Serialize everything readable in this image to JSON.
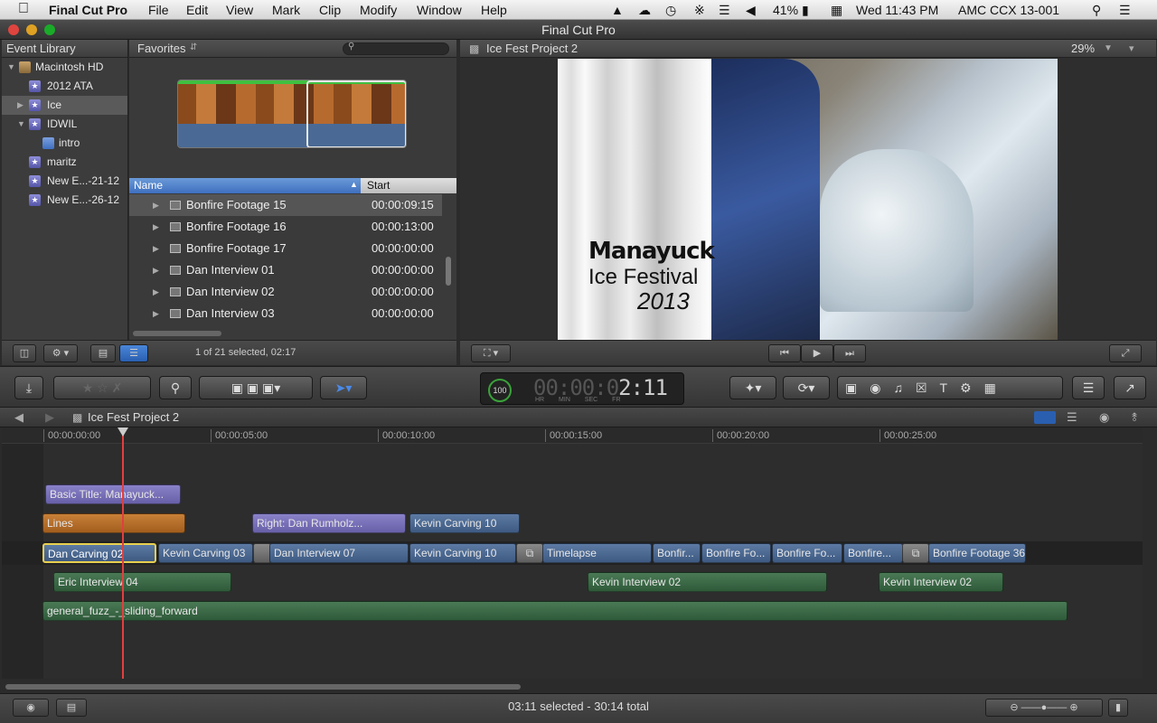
{
  "menubar": {
    "apple": "",
    "app_name": "Final Cut Pro",
    "menus": [
      "File",
      "Edit",
      "View",
      "Mark",
      "Clip",
      "Modify",
      "Window",
      "Help"
    ],
    "battery": "41%",
    "clock": "Wed 11:43 PM",
    "user": "AMC CCX 13-001"
  },
  "window": {
    "title": "Final Cut Pro"
  },
  "event_library": {
    "title": "Event Library",
    "items": [
      {
        "label": "Macintosh HD",
        "icon": "hard-drive-icon",
        "expanded": true
      },
      {
        "label": "2012 ATA",
        "icon": "event-star-icon"
      },
      {
        "label": "Ice",
        "icon": "event-star-icon",
        "selected": true
      },
      {
        "label": "IDWIL",
        "icon": "event-star-icon",
        "expanded": true
      },
      {
        "label": "intro",
        "icon": "keyword-collection-icon"
      },
      {
        "label": "maritz",
        "icon": "event-star-icon"
      },
      {
        "label": "New E...-21-12",
        "icon": "event-star-icon"
      },
      {
        "label": "New E...-26-12",
        "icon": "event-star-icon"
      }
    ]
  },
  "browser": {
    "filter": "Favorites",
    "columns": {
      "name": "Name",
      "start": "Start"
    },
    "rows": [
      {
        "name": "Bonfire Footage 15",
        "start": "00:00:09:15",
        "selected": true
      },
      {
        "name": "Bonfire Footage 16",
        "start": "00:00:13:00"
      },
      {
        "name": "Bonfire Footage 17",
        "start": "00:00:00:00"
      },
      {
        "name": "Dan Interview 01",
        "start": "00:00:00:00"
      },
      {
        "name": "Dan Interview 02",
        "start": "00:00:00:00"
      },
      {
        "name": "Dan Interview 03",
        "start": "00:00:00:00"
      }
    ],
    "status": "1 of 21 selected, 02:17"
  },
  "viewer": {
    "title": "Ice Fest Project 2",
    "zoom": "29%",
    "overlay": {
      "line1": "Manayuck",
      "line2": "Ice Festival",
      "line3": "2013"
    }
  },
  "toolbar": {
    "timecode_dim": "00:00:0",
    "timecode_lit": "2:11",
    "percent": "100",
    "tc_labels": "HR MIN SEC FR"
  },
  "timeline": {
    "project": "Ice Fest Project 2",
    "ruler": [
      "00:00:00:00",
      "00:00:05:00",
      "00:00:10:00",
      "00:00:15:00",
      "00:00:20:00",
      "00:00:25:00"
    ],
    "clips": {
      "title": "Basic Title: Manayuck...",
      "lines": "Lines",
      "right_dan": "Right: Dan Rumholz...",
      "kevin10_top": "Kevin Carving 10",
      "dan_carving": "Dan Carving 02",
      "kevin03": "Kevin Carving 03",
      "dan_int07": "Dan Interview 07",
      "kevin10": "Kevin Carving 10",
      "timelapse": "Timelapse",
      "bonf1": "Bonfir...",
      "bonf2": "Bonfire Fo...",
      "bonf3": "Bonfire Fo...",
      "bonf4": "Bonfire...",
      "bonf36": "Bonfire Footage 36",
      "eric04": "Eric Interview 04",
      "kevint02a": "Kevin Interview 02",
      "kevint02b": "Kevin Interview 02",
      "fuzz": "general_fuzz_-_sliding_forward"
    }
  },
  "status": {
    "text": "03:11 selected - 30:14 total"
  }
}
